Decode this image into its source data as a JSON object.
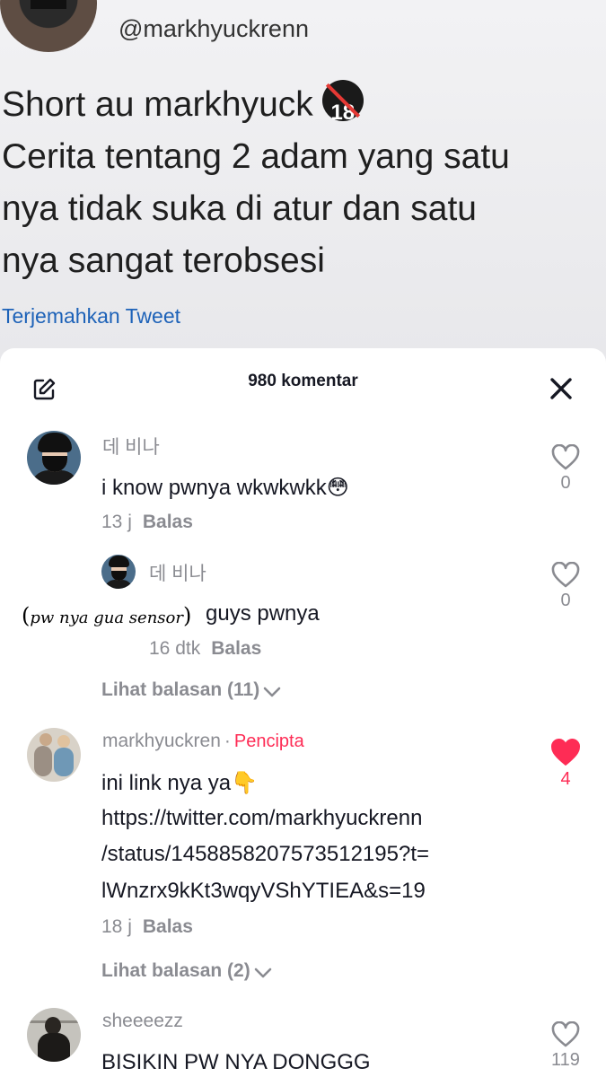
{
  "tweet": {
    "handle": "@markhyuckrenn",
    "lines": [
      "Short au markhyuck",
      "Cerita tentang 2 adam yang satu",
      "nya tidak suka di atur dan satu",
      "nya sangat terobsesi"
    ],
    "age_badge": "18",
    "translate": "Terjemahkan Tweet"
  },
  "sheet": {
    "title": "980 komentar",
    "icons": {
      "edit": "edit-icon",
      "close": "close-icon"
    }
  },
  "comments": [
    {
      "username": "데 비나",
      "text": "i know pwnya wkwkwkk😳",
      "time": "13 j",
      "reply": "Balas",
      "likes": "0",
      "reply_item": {
        "username": "데 비나",
        "text": "guys pwnya",
        "annotation": "pw nya gua sensor",
        "time": "16 dtk",
        "reply": "Balas",
        "likes": "0"
      },
      "view_replies": "Lihat balasan (11)"
    },
    {
      "username": "markhyuckren",
      "creator_label": "Pencipta",
      "text_lines": [
        "ini link nya ya👇",
        "https://twitter.com/markhyuckrenn",
        "/status/1458858207573512195?t=",
        "lWnzrx9kKt3wqyVShYTIEA&s=19"
      ],
      "time": "18 j",
      "reply": "Balas",
      "likes": "4",
      "liked": true,
      "view_replies": "Lihat balasan (2)"
    },
    {
      "username": "sheeeezz",
      "text": "BISIKIN PW NYA DONGGG",
      "likes": "119"
    }
  ],
  "colors": {
    "accent": "#fe2c55",
    "muted": "#8a8b91",
    "link": "#1d62b8"
  }
}
